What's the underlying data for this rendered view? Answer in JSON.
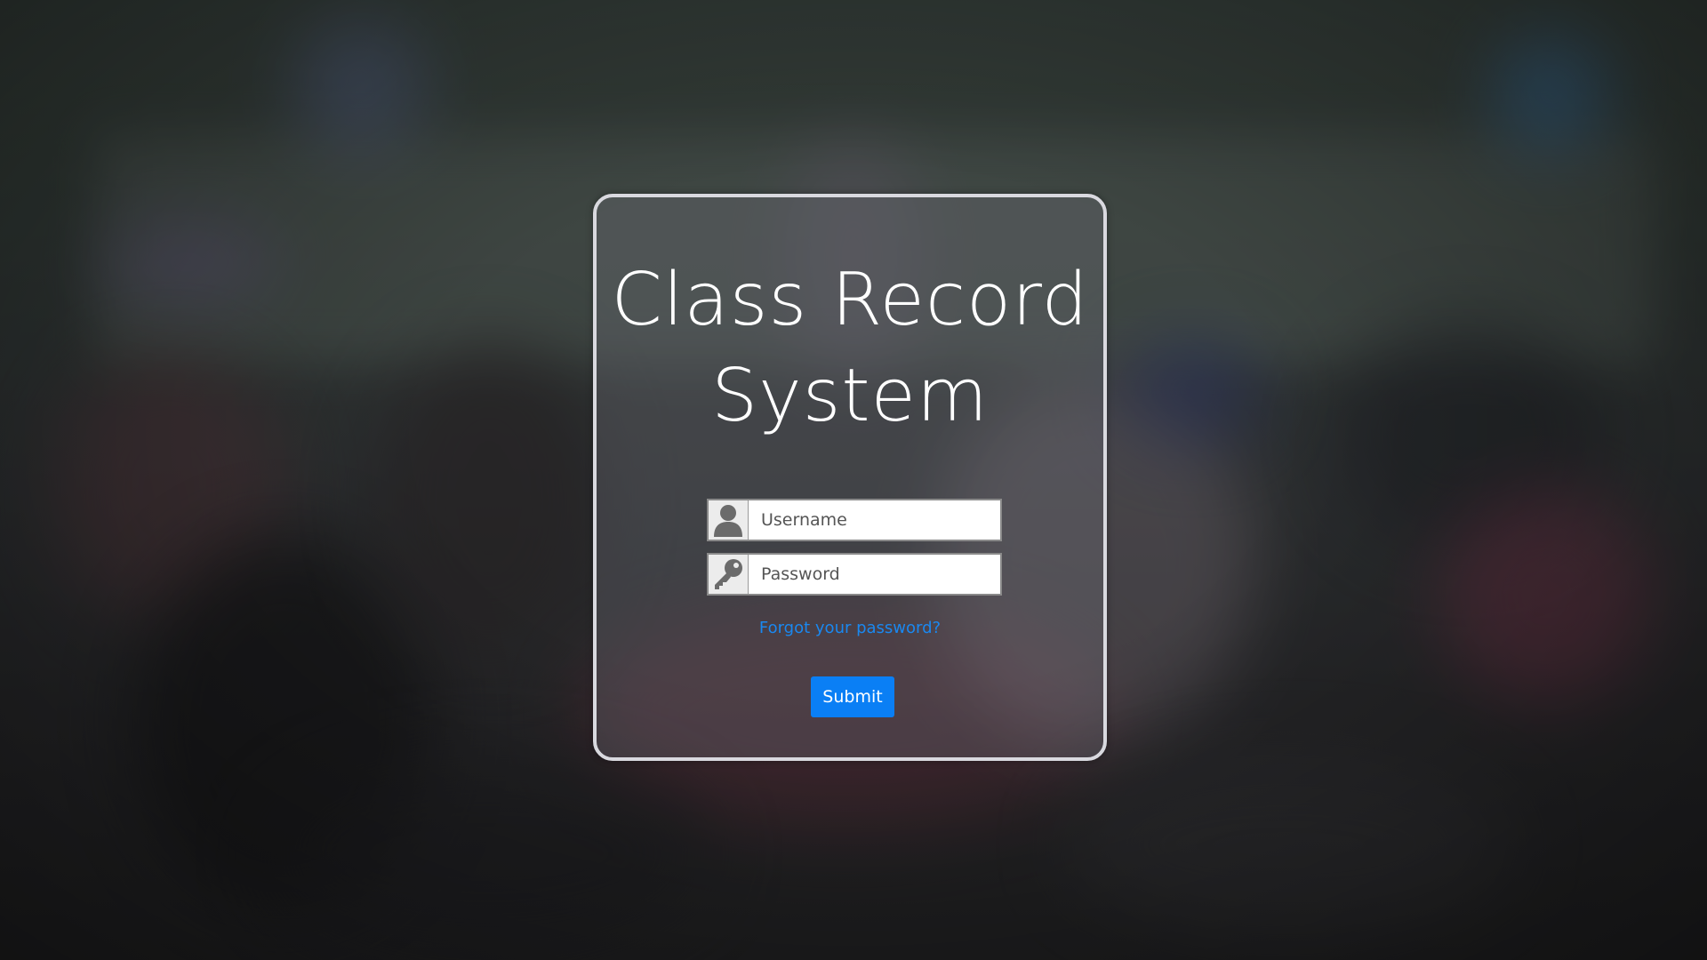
{
  "app": {
    "title_line1": "Class Record",
    "title_line2": "System"
  },
  "login": {
    "username": {
      "placeholder": "Username",
      "value": "",
      "icon": "user-icon"
    },
    "password": {
      "placeholder": "Password",
      "value": "",
      "icon": "key-icon"
    },
    "forgot_link": "Forgot your password?",
    "submit_label": "Submit"
  },
  "colors": {
    "link": "#1a88f0",
    "submit_bg": "#0a7ff5",
    "card_border": "#d9d9df",
    "title_text": "#ffffff"
  }
}
